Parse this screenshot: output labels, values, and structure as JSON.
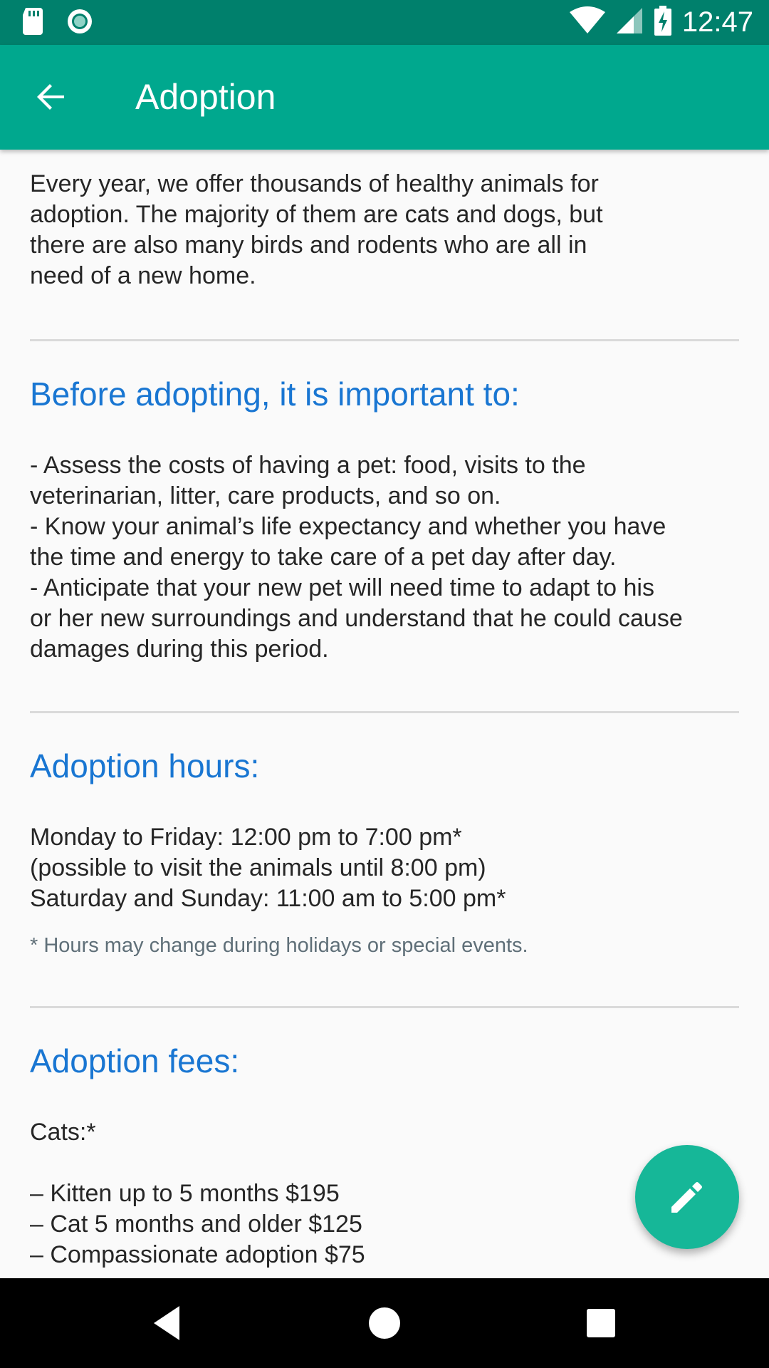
{
  "status_bar": {
    "time": "12:47",
    "icons": [
      "sd-card-icon",
      "sync-circle-icon",
      "wifi-icon",
      "signal-icon",
      "battery-charging-icon"
    ]
  },
  "app_bar": {
    "title": "Adoption",
    "back_icon": "arrow-back-icon",
    "color": "#00a88e"
  },
  "content": {
    "intro": "Every year, we offer thousands of healthy animals for\nadoption. The majority of them are cats and dogs, but\nthere are also many birds and rodents who are all in\nneed of a new home.",
    "before_heading": "Before adopting, it is important to:",
    "before_text": "- Assess the costs of having a pet: food, visits to the\nveterinarian, litter, care products, and so on.\n- Know your animal’s life expectancy and whether you have\nthe time and energy to take care of a pet day after day.\n- Anticipate that your new pet will need time to adapt to his\nor her new surroundings and understand that he could cause\ndamages during this period.",
    "hours_heading": "Adoption hours:",
    "hours_text": "Monday to Friday: 12:00 pm to 7:00 pm*\n(possible to visit the animals until 8:00 pm)\nSaturday and Sunday: 11:00 am to 5:00 pm*",
    "hours_note": "* Hours may change during holidays or special events.",
    "fees_heading": "Adoption fees:",
    "fees_cats": "Cats:*",
    "fees_list": "– Kitten up to 5 months $195\n– Cat 5 months and older $125\n– Compassionate adoption $75",
    "heading_color": "#1976d2"
  },
  "fab": {
    "icon": "pencil-edit-icon",
    "color": "#16b798"
  },
  "nav_bar": {
    "icons": [
      "nav-back-icon",
      "nav-home-icon",
      "nav-recents-icon"
    ]
  }
}
